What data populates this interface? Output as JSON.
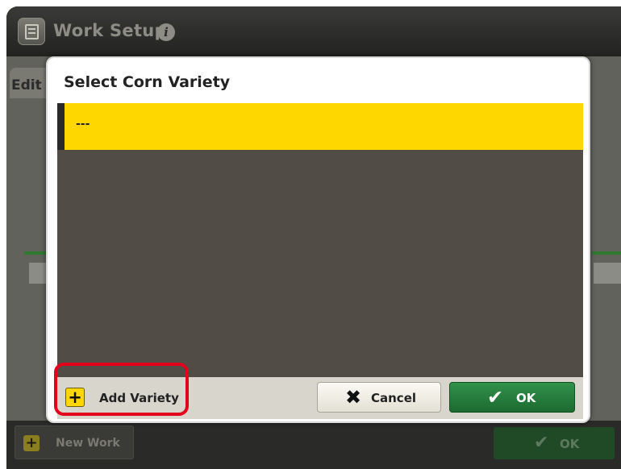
{
  "window": {
    "title": "Work Setup"
  },
  "background": {
    "tab_label": "Edit"
  },
  "dialog": {
    "title": "Select Corn Variety",
    "list_items": [
      {
        "label": "---",
        "selected": true
      }
    ],
    "add_variety_label": "Add Variety",
    "cancel_label": "Cancel",
    "ok_label": "OK"
  },
  "bottom_bar": {
    "new_work_label": "New Work",
    "ok_label": "OK"
  },
  "icons": {
    "app": "work-setup-icon",
    "info": "info-icon",
    "add": "plus-icon",
    "cancel": "x-icon",
    "ok": "check-icon"
  },
  "colors": {
    "selected_row": "#ffd700",
    "list_background": "#524c46",
    "ok_button": "#1c6a30",
    "highlight_ring": "#e3001b"
  }
}
